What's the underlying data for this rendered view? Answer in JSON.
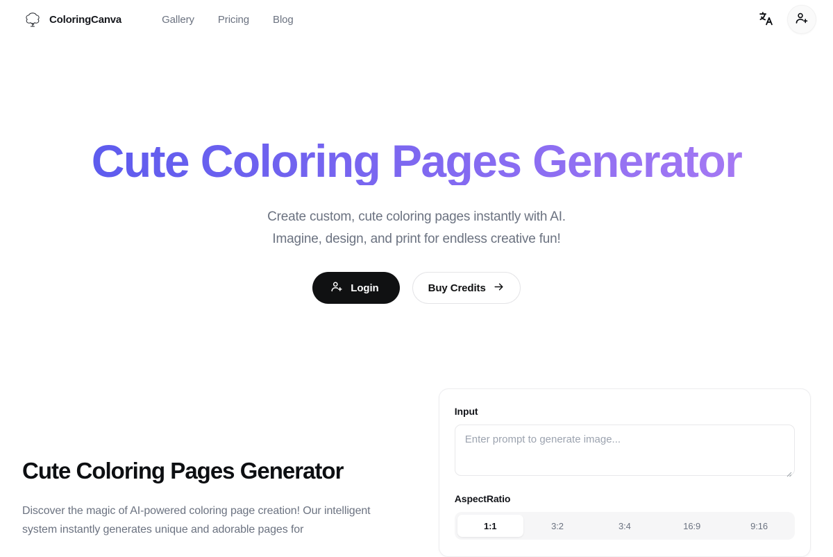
{
  "header": {
    "brand_name": "ColoringCanva",
    "logo_icon": "tree-icon",
    "nav": [
      {
        "label": "Gallery"
      },
      {
        "label": "Pricing"
      },
      {
        "label": "Blog"
      }
    ],
    "language_icon": "translate-icon",
    "account_icon": "user-plus-icon"
  },
  "hero": {
    "title": "Cute Coloring Pages Generator",
    "subtitle_line1": "Create custom, cute coloring pages instantly with AI.",
    "subtitle_line2": "Imagine, design, and print for endless creative fun!",
    "primary_button": {
      "label": "Login",
      "icon": "user-plus-icon"
    },
    "secondary_button": {
      "label": "Buy Credits",
      "icon": "arrow-right-icon"
    },
    "gradient_from": "#5558ee",
    "gradient_to": "#b07ef4"
  },
  "content": {
    "heading": "Cute Coloring Pages Generator",
    "paragraph": "Discover the magic of AI-powered coloring page creation! Our intelligent system instantly generates unique and adorable pages for"
  },
  "generator": {
    "input_label": "Input",
    "input_value": "",
    "input_placeholder": "Enter prompt to generate image...",
    "aspect_ratio_label": "AspectRatio",
    "aspect_ratios": [
      {
        "label": "1:1",
        "selected": true
      },
      {
        "label": "3:2",
        "selected": false
      },
      {
        "label": "3:4",
        "selected": false
      },
      {
        "label": "16:9",
        "selected": false
      },
      {
        "label": "9:16",
        "selected": false
      }
    ]
  }
}
